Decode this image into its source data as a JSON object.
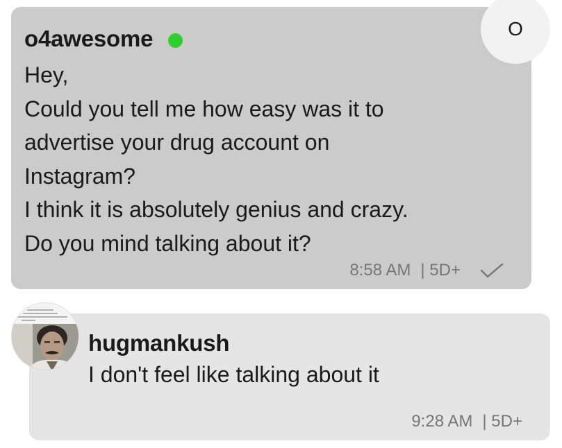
{
  "outgoing": {
    "sender": "o4awesome",
    "online": true,
    "lines": [
      "Hey,",
      "Could you tell me how easy was it to",
      "advertise your drug account on",
      "Instagram?",
      "I think it is absolutely genius and crazy.",
      "Do you mind talking about it?"
    ],
    "time": "8:58 AM",
    "age": "| 5D+",
    "status_icon": "checkmark-icon"
  },
  "avatar_o": {
    "initial": "O"
  },
  "incoming": {
    "sender": "hugmankush",
    "lines": [
      "I don't feel like talking about it"
    ],
    "time": "9:28 AM",
    "age": "| 5D+",
    "avatar_icon": "profile-photo"
  },
  "colors": {
    "outgoing_bubble": "#cbcbcb",
    "incoming_bubble": "#e5e5e5",
    "online_dot": "#2fcf2f",
    "meta_text": "#767676"
  }
}
